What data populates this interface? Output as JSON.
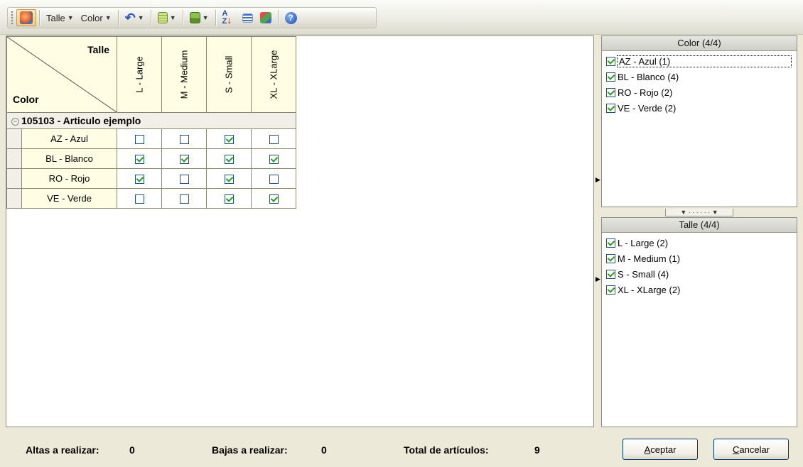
{
  "toolbar": {
    "talle_label": "Talle",
    "color_label": "Color"
  },
  "grid": {
    "corner_top": "Talle",
    "corner_left": "Color",
    "columns": [
      "L - Large",
      "M - Medium",
      "S - Small",
      "XL - XLarge"
    ],
    "group_label": "105103 - Articulo ejemplo",
    "rows": [
      {
        "label": "AZ - Azul",
        "checks": [
          false,
          false,
          true,
          false
        ]
      },
      {
        "label": "BL - Blanco",
        "checks": [
          true,
          true,
          true,
          true
        ]
      },
      {
        "label": "RO - Rojo",
        "checks": [
          true,
          false,
          true,
          false
        ]
      },
      {
        "label": "VE - Verde",
        "checks": [
          false,
          false,
          true,
          true
        ]
      }
    ]
  },
  "color_panel": {
    "title": "Color (4/4)",
    "items": [
      {
        "label": "AZ - Azul (1)",
        "checked": true
      },
      {
        "label": "BL - Blanco (4)",
        "checked": true
      },
      {
        "label": "RO - Rojo (2)",
        "checked": true
      },
      {
        "label": "VE - Verde (2)",
        "checked": true
      }
    ]
  },
  "talle_panel": {
    "title": "Talle (4/4)",
    "items": [
      {
        "label": "L - Large (2)",
        "checked": true
      },
      {
        "label": "M - Medium (1)",
        "checked": true
      },
      {
        "label": "S - Small (4)",
        "checked": true
      },
      {
        "label": "XL - XLarge (2)",
        "checked": true
      }
    ]
  },
  "status": {
    "altas_label": "Altas a realizar:",
    "altas_value": "0",
    "bajas_label": "Bajas a realizar:",
    "bajas_value": "0",
    "total_label": "Total de artículos:",
    "total_value": "9"
  },
  "buttons": {
    "accept_first": "A",
    "accept_rest": "ceptar",
    "cancel_first": "C",
    "cancel_rest": "ancelar"
  },
  "colors": {
    "header_bg": "#fffde3",
    "check_green": "#21a121",
    "window_bg": "#ece9d8"
  },
  "icons": [
    "refresh-icon",
    "undo-icon",
    "grid-icon",
    "save-icon",
    "sort-icon",
    "properties-icon",
    "filter-icon",
    "help-icon"
  ]
}
